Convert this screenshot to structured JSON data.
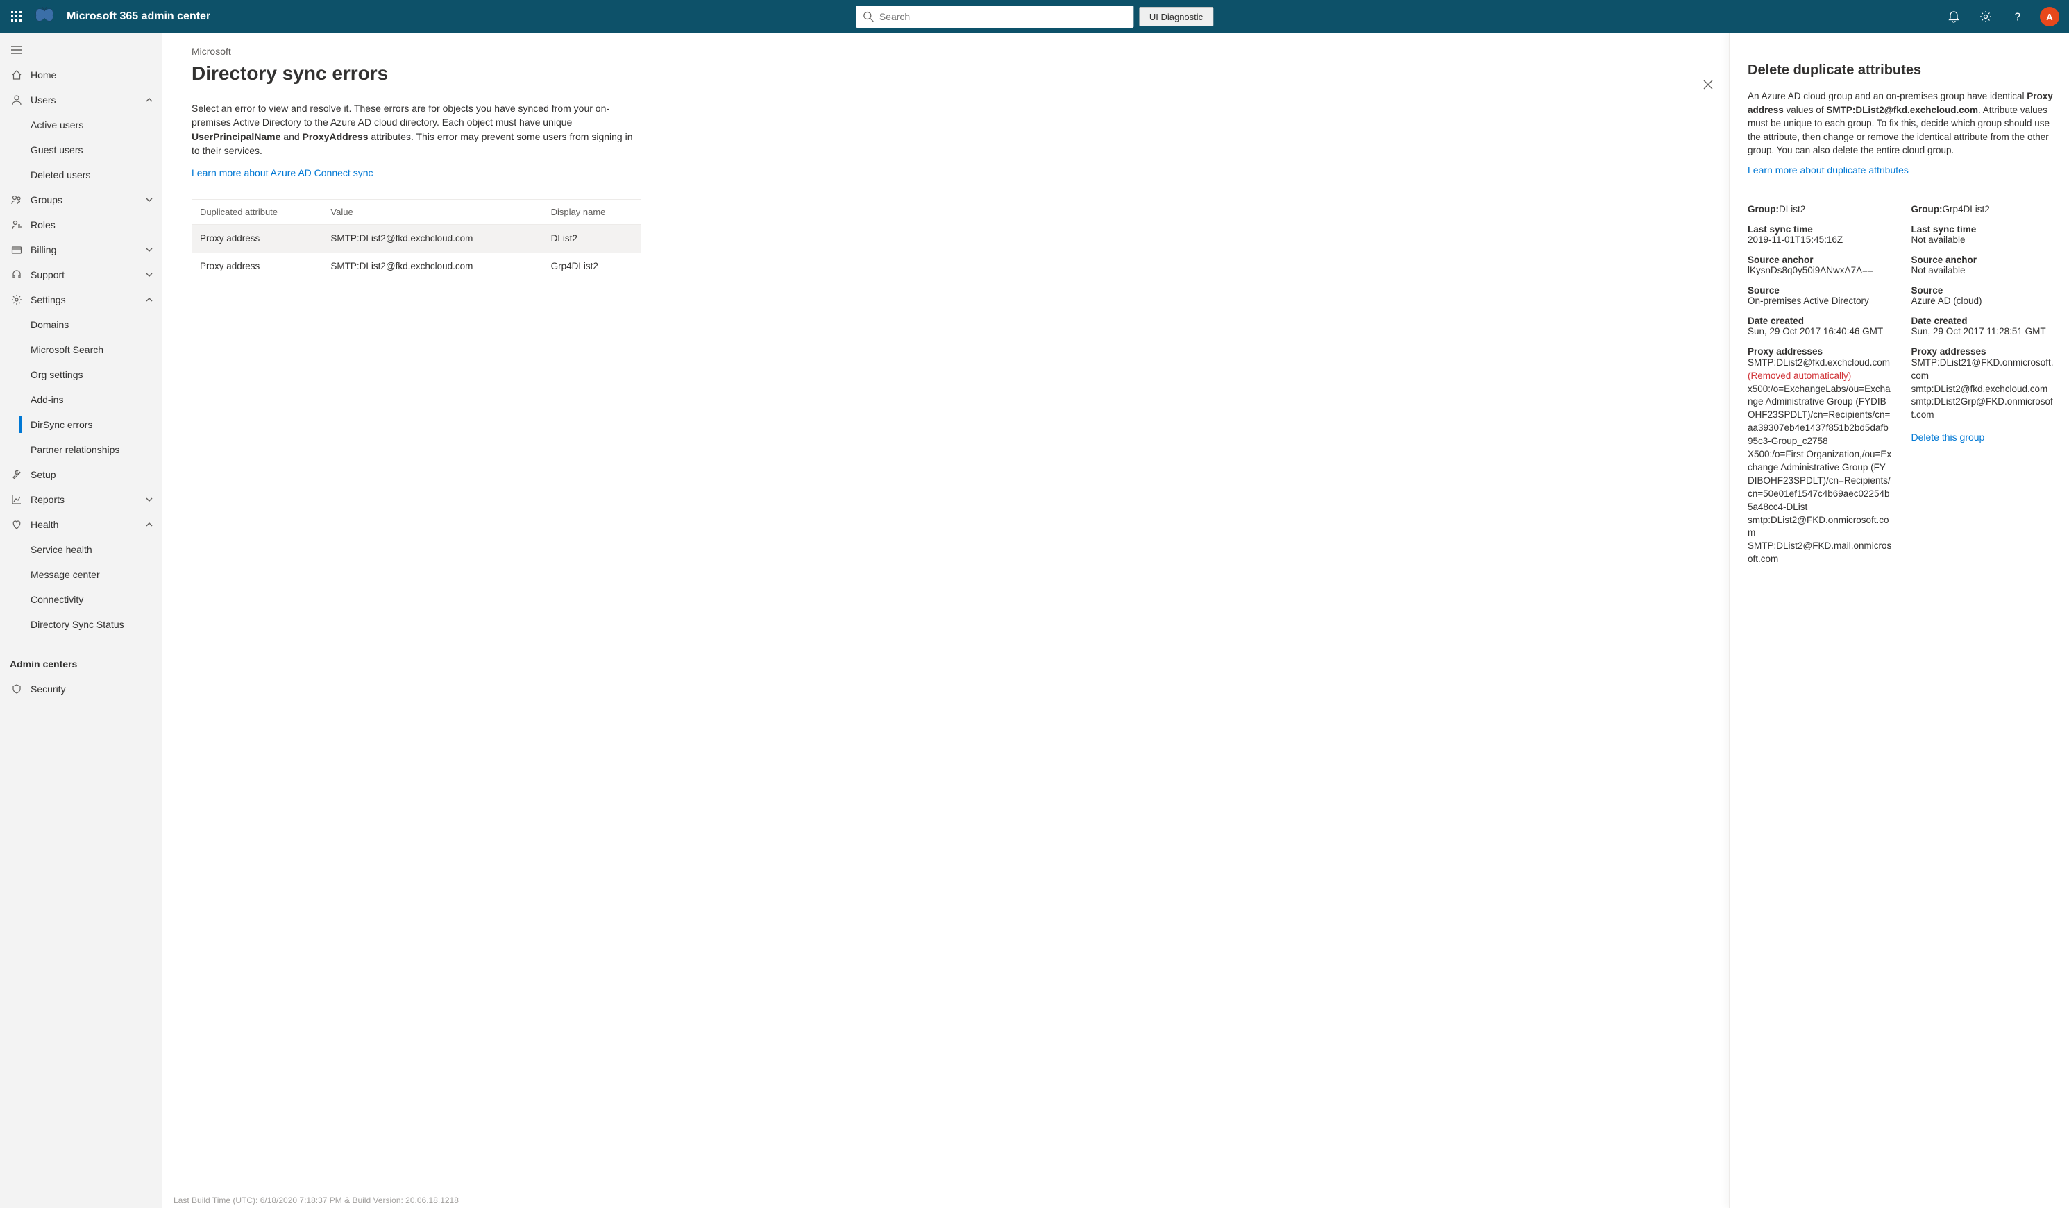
{
  "header": {
    "title": "Microsoft 365 admin center",
    "search_placeholder": "Search",
    "ui_diag": "UI Diagnostic",
    "avatar_initial": "A"
  },
  "sidebar": {
    "home": "Home",
    "users": "Users",
    "users_children": {
      "active": "Active users",
      "guest": "Guest users",
      "deleted": "Deleted users"
    },
    "groups": "Groups",
    "roles": "Roles",
    "billing": "Billing",
    "support": "Support",
    "settings": "Settings",
    "settings_children": {
      "domains": "Domains",
      "mssearch": "Microsoft Search",
      "org": "Org settings",
      "addins": "Add-ins",
      "dirsync": "DirSync errors",
      "partner": "Partner relationships"
    },
    "setup": "Setup",
    "reports": "Reports",
    "health": "Health",
    "health_children": {
      "service": "Service health",
      "message": "Message center",
      "connectivity": "Connectivity",
      "dirstatus": "Directory Sync Status"
    },
    "admin_centers": "Admin centers",
    "security": "Security"
  },
  "main": {
    "breadcrumb": "Microsoft",
    "title": "Directory sync errors",
    "intro_pre": "Select an error to view and resolve it. These errors are for objects you have synced from your on-premises Active Directory to the Azure AD cloud directory. Each object must have unique ",
    "intro_b1": "UserPrincipalName",
    "intro_mid": " and ",
    "intro_b2": "ProxyAddress",
    "intro_post": " attributes. This error may prevent some users from signing in to their services.",
    "learn": "Learn more about Azure AD Connect sync",
    "columns": {
      "dup": "Duplicated attribute",
      "val": "Value",
      "disp": "Display name"
    },
    "rows": [
      {
        "dup": "Proxy address",
        "val": "SMTP:DList2@fkd.exchcloud.com",
        "disp": "DList2",
        "selected": true
      },
      {
        "dup": "Proxy address",
        "val": "SMTP:DList2@fkd.exchcloud.com",
        "disp": "Grp4DList2",
        "selected": false
      }
    ],
    "build": "Last Build Time (UTC): 6/18/2020 7:18:37 PM & Build Version: 20.06.18.1218"
  },
  "panel": {
    "title": "Delete duplicate attributes",
    "desc_pre": "An Azure AD cloud group and an on-premises group have identical ",
    "desc_b1": "Proxy address",
    "desc_mid": " values of ",
    "desc_b2": "SMTP:DList2@fkd.exchcloud.com",
    "desc_post": ". Attribute values must be unique to each group. To fix this, decide which group should use the attribute, then change or remove the identical attribute from the other group. You can also delete the entire cloud group.",
    "learn": "Learn more about duplicate attributes",
    "left": {
      "group_label": "Group:",
      "group": "DList2",
      "last_sync_label": "Last sync time",
      "last_sync": "2019-11-01T15:45:16Z",
      "anchor_label": "Source anchor",
      "anchor": "lKysnDs8q0y50i9ANwxA7A==",
      "source_label": "Source",
      "source": "On-premises Active Directory",
      "created_label": "Date created",
      "created": "Sun, 29 Oct 2017 16:40:46 GMT",
      "proxy_label": "Proxy addresses",
      "proxy": [
        "SMTP:DList2@fkd.exchcloud.com",
        "(Removed automatically)",
        "x500:/o=ExchangeLabs/ou=Exchange Administrative Group (FYDIBOHF23SPDLT)/cn=Recipients/cn=aa39307eb4e1437f851b2bd5dafb95c3-Group_c2758",
        "X500:/o=First Organization,/ou=Exchange Administrative Group (FYDIBOHF23SPDLT)/cn=Recipients/cn=50e01ef1547c4b69aec02254b5a48cc4-DList",
        "smtp:DList2@FKD.onmicrosoft.com",
        "SMTP:DList2@FKD.mail.onmicrosoft.com"
      ]
    },
    "right": {
      "group_label": "Group:",
      "group": "Grp4DList2",
      "last_sync_label": "Last sync time",
      "last_sync": "Not available",
      "anchor_label": "Source anchor",
      "anchor": "Not available",
      "source_label": "Source",
      "source": "Azure AD (cloud)",
      "created_label": "Date created",
      "created": "Sun, 29 Oct 2017 11:28:51 GMT",
      "proxy_label": "Proxy addresses",
      "proxy": [
        "SMTP:DList21@FKD.onmicrosoft.com",
        "smtp:DList2@fkd.exchcloud.com",
        "smtp:DList2Grp@FKD.onmicrosoft.com"
      ],
      "delete": "Delete this group"
    }
  }
}
